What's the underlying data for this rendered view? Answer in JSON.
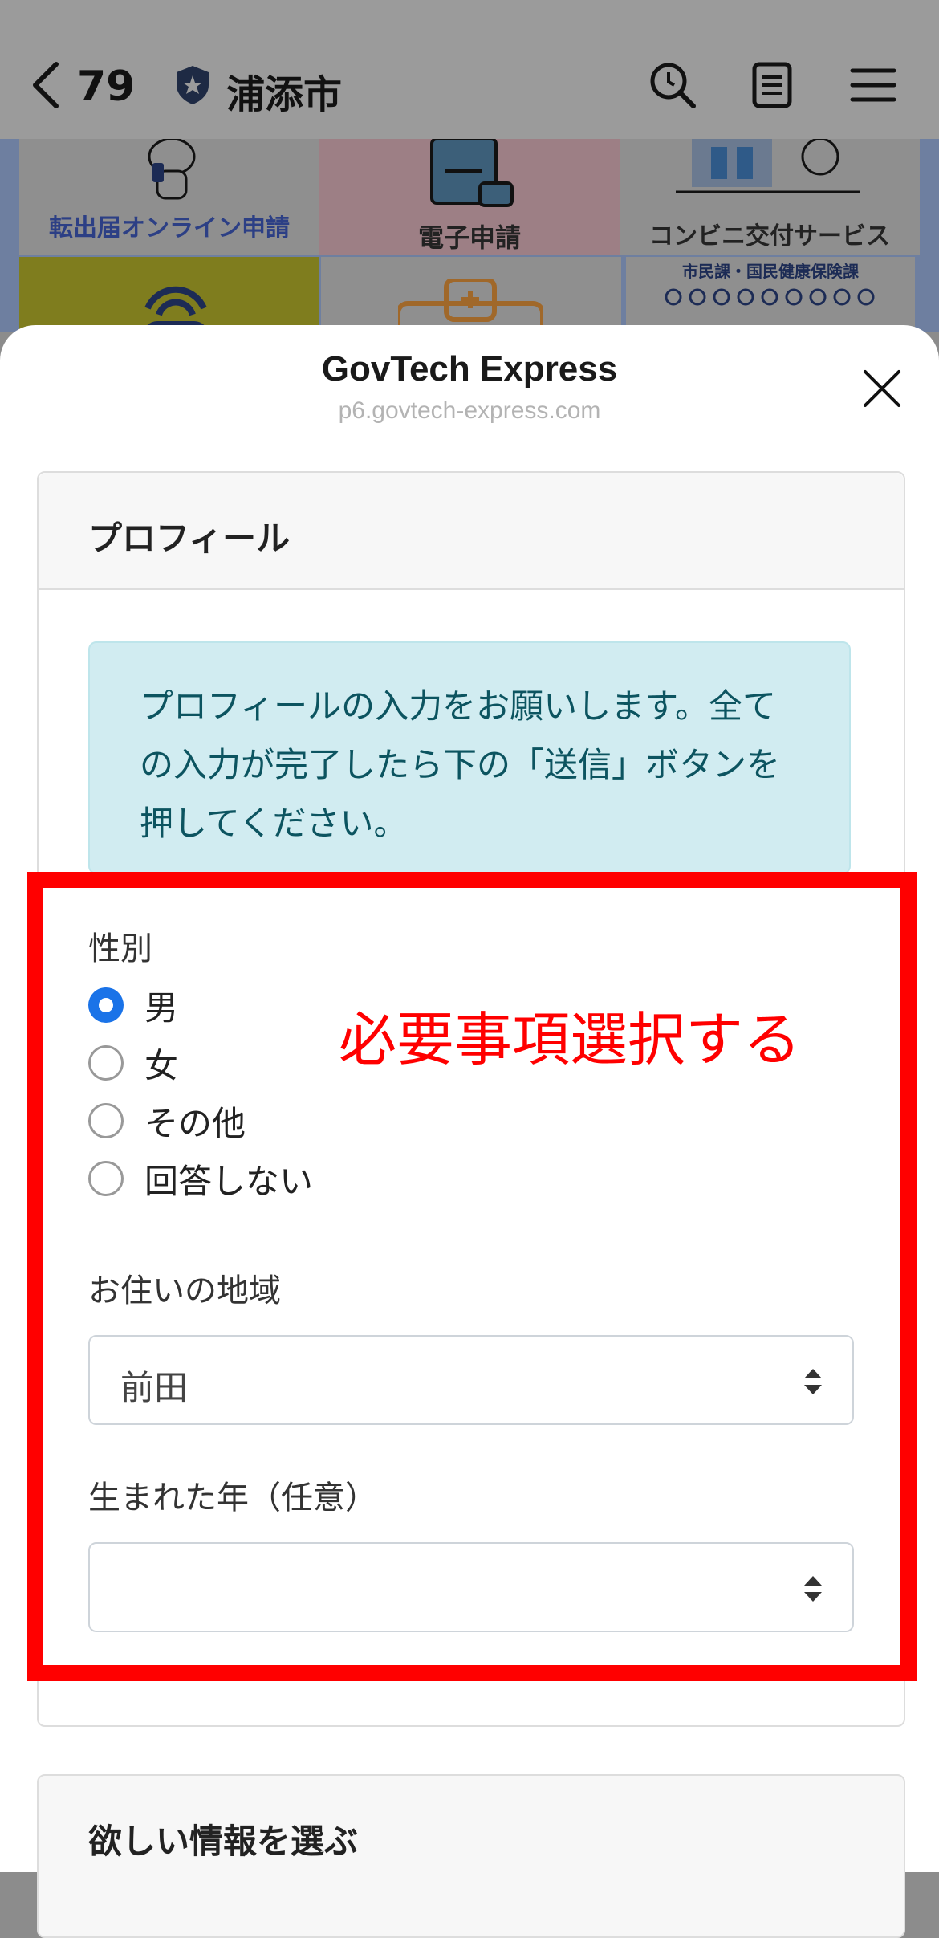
{
  "header": {
    "back_count": "79",
    "title": "浦添市"
  },
  "tiles": {
    "t1": "転出届オンライン申請",
    "t2": "電子申請",
    "t3": "コンビニ交付サービス",
    "t6": "市民課・国民健康保険課"
  },
  "sheet": {
    "title": "GovTech Express",
    "url": "p6.govtech-express.com"
  },
  "profile": {
    "heading": "プロフィール",
    "notice": "プロフィールの入力をお願いします。全ての入力が完了したら下の「送信」ボタンを押してください。",
    "gender_label": "性別",
    "gender_options": [
      "男",
      "女",
      "その他",
      "回答しない"
    ],
    "gender_selected": "男",
    "region_label": "お住いの地域",
    "region_value": "前田",
    "birth_label": "生まれた年（任意）",
    "birth_value": ""
  },
  "annotation": "必要事項選択する",
  "next_section": {
    "heading": "欲しい情報を選ぶ"
  },
  "colors": {
    "accent": "#1a73e8",
    "annotation": "#ff0000",
    "alert_bg": "#d1ecf1"
  }
}
